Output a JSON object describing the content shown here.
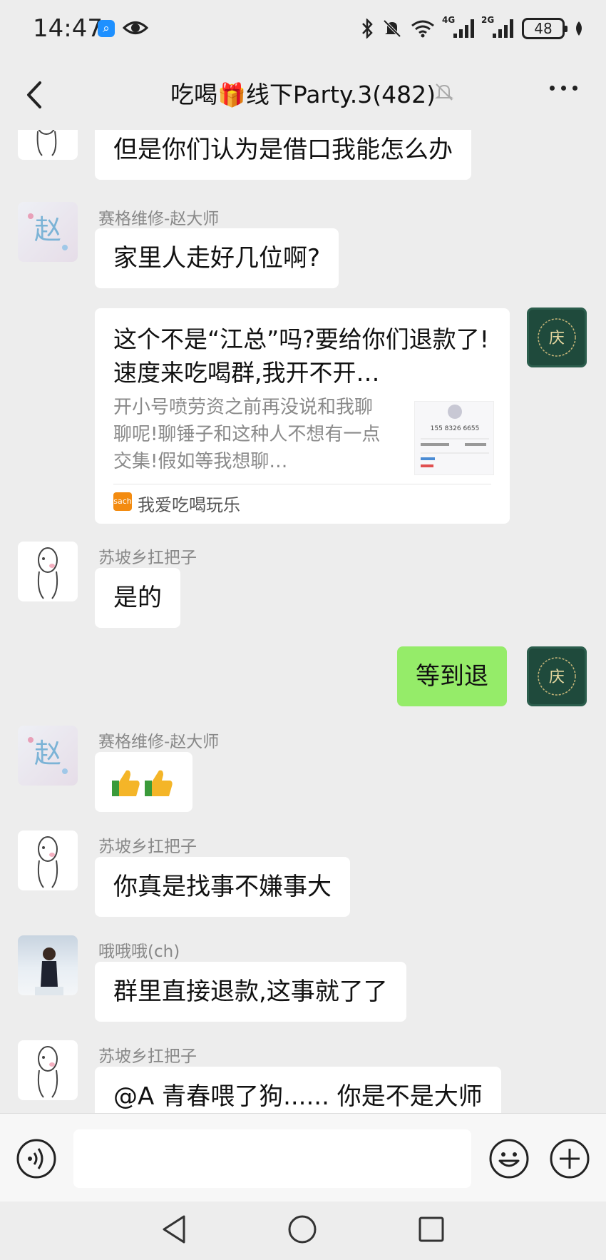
{
  "status_bar": {
    "time": "14:47",
    "network_4g": "4G",
    "network_2g": "2G",
    "battery": "48"
  },
  "header": {
    "title_prefix": "吃喝",
    "title_suffix": "线下Party.3(482)"
  },
  "messages": [
    {
      "text": "但是你们认为是借口我能怎么办"
    },
    {
      "sender": "赛格维修-赵大师",
      "text": "家里人走好几位啊?"
    },
    {
      "card": {
        "title": "这个不是“江总”吗?要给你们退款了!速度来吃喝群,我开不开…",
        "desc": "开小号喷劳资之前再没说和我聊聊呢!聊锤子和这种人不想有一点交集!假如等我想聊…",
        "source": "我爱吃喝玩乐",
        "thumb_phone": "155 8326 6655"
      }
    },
    {
      "sender": "苏坡乡扛把子",
      "text": "是的"
    },
    {
      "text": "等到退",
      "from_me": true
    },
    {
      "sender": "赛格维修-赵大师",
      "emoji": "thumbs-up x2"
    },
    {
      "sender": "苏坡乡扛把子",
      "text": "你真是找事不嫌事大"
    },
    {
      "sender": "哦哦哦(ch)",
      "text": "群里直接退款,这事就了了"
    },
    {
      "sender": "苏坡乡扛把子",
      "text": "@A 青春喂了狗...... 你是不是大师"
    }
  ],
  "input": {
    "placeholder": ""
  },
  "colors": {
    "my_bubble": "#95ec69",
    "background": "#ededed",
    "bubble": "#ffffff"
  },
  "avatar_zhao": {
    "glyph": "赵"
  },
  "avatar_me": {
    "glyph": "庆"
  }
}
